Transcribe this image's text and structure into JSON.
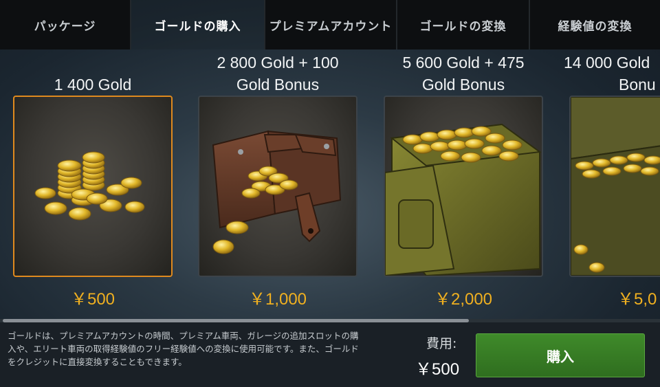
{
  "tabs": [
    {
      "label": "パッケージ"
    },
    {
      "label": "ゴールドの購入"
    },
    {
      "label": "プレミアムアカウント"
    },
    {
      "label": "ゴールドの変換"
    },
    {
      "label": "経験値の変換"
    }
  ],
  "offers": [
    {
      "title_line1": "",
      "title_line2": "1 400 Gold",
      "price": "￥500",
      "art": "coin-pile-icon"
    },
    {
      "title_line1": "2 800 Gold + 100",
      "title_line2": "Gold Bonus",
      "price": "￥1,000",
      "art": "leather-pouch-coins-icon"
    },
    {
      "title_line1": "5 600 Gold + 475",
      "title_line2": "Gold Bonus",
      "price": "￥2,000",
      "art": "ammo-box-coins-icon"
    },
    {
      "title_line1": "14 000 Gold",
      "title_line2": "Bonu",
      "price": "￥5,0",
      "art": "crate-coins-icon"
    }
  ],
  "footer": {
    "description": "ゴールドは、プレミアムアカウントの時間、プレミアム車両、ガレージの追加スロットの購入や、エリート車両の取得経験値のフリー経験値への変換に使用可能です。また、ゴールドをクレジットに直接変換することもできます。",
    "cost_label": "費用:",
    "cost_value": "￥500",
    "buy_label": "購入"
  },
  "colors": {
    "accent_price": "#f0b020",
    "buy_button": "#3f8a2a",
    "selected_border": "#e08a1e"
  }
}
